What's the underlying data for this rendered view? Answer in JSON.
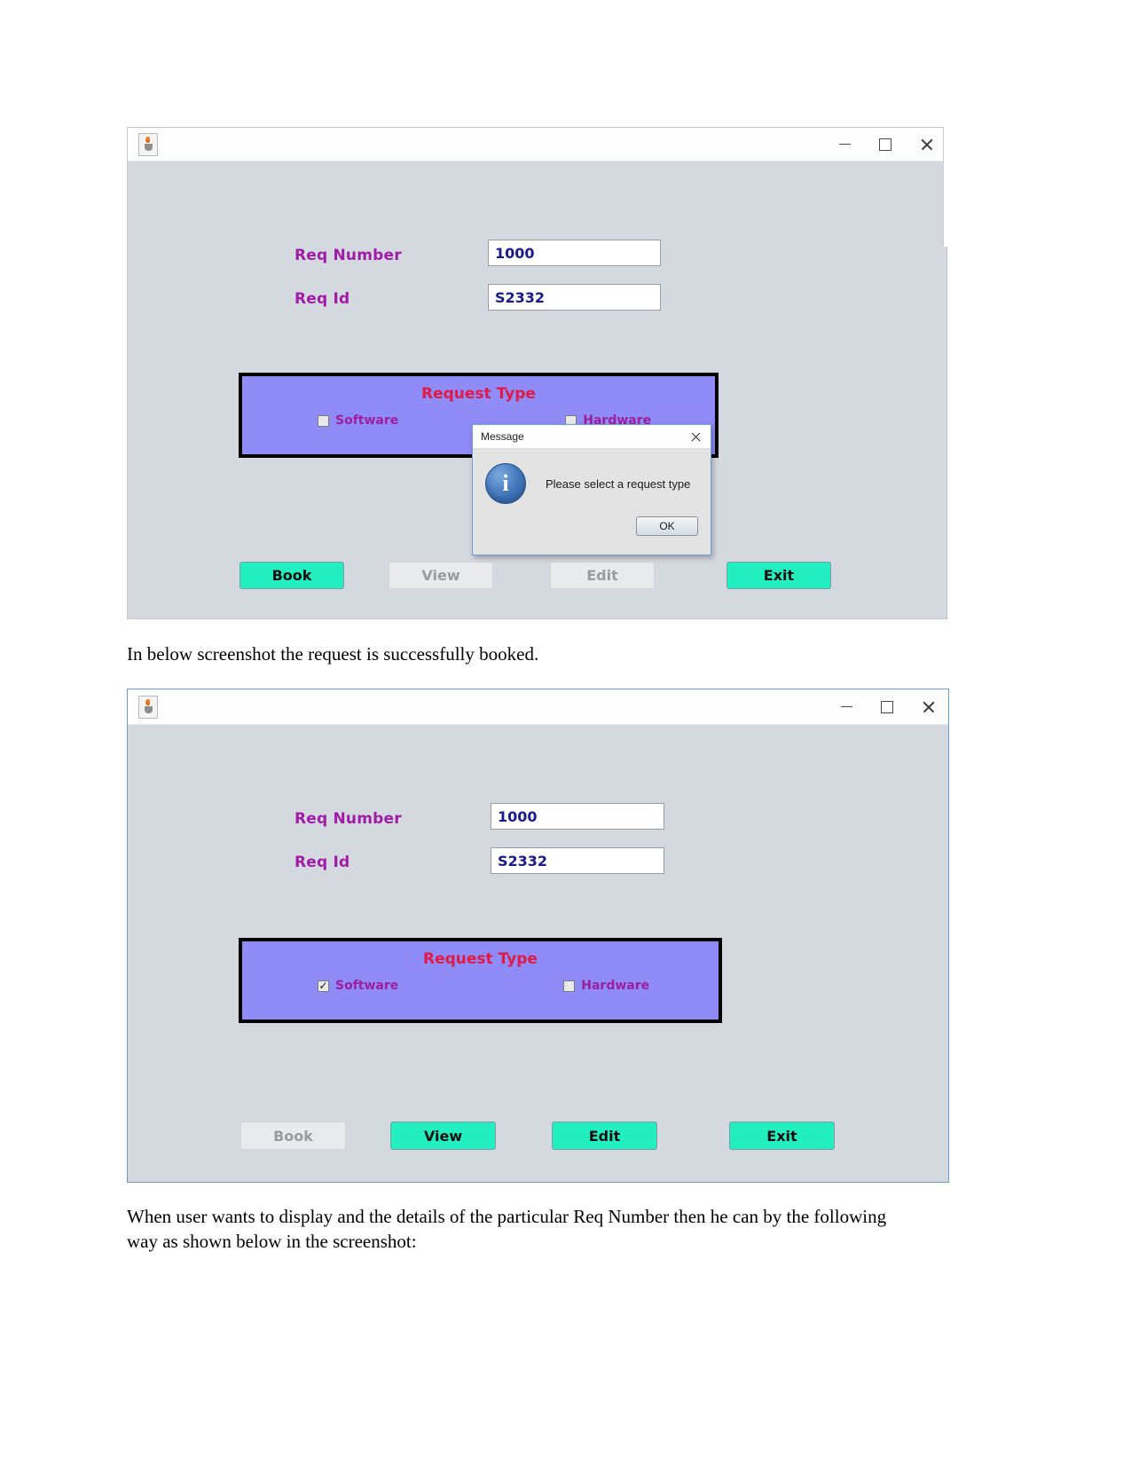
{
  "document": {
    "paragraph_1": "In below screenshot the request is successfully booked.",
    "paragraph_2": "When user wants to display and the details of the particular Req Number then he can by the following way as shown below in the screenshot:"
  },
  "colors": {
    "panel_background": "#8f8bf7",
    "panel_title": "#e01a45",
    "label": "#a01ca8",
    "input_text": "#1a1a8c",
    "button_active": "#21efc0",
    "button_disabled": "#e8eaec",
    "window_background": "#d4d8df"
  },
  "window_1": {
    "titlebar": {
      "app_icon": "java-cup-icon",
      "minimize": "minimize-icon",
      "maximize": "maximize-icon",
      "close": "close-icon"
    },
    "fields": [
      {
        "label": "Req Number",
        "value": "1000"
      },
      {
        "label": "Req Id",
        "value": "S2332"
      }
    ],
    "request_type": {
      "title": "Request Type",
      "options": [
        {
          "label": "Software",
          "checked": false
        },
        {
          "label": "Hardware",
          "checked": false
        }
      ]
    },
    "buttons": [
      {
        "label": "Book",
        "enabled": true
      },
      {
        "label": "View",
        "enabled": false
      },
      {
        "label": "Edit",
        "enabled": false
      },
      {
        "label": "Exit",
        "enabled": true
      }
    ],
    "dialog": {
      "title": "Message",
      "icon": "info-icon",
      "glyph": "i",
      "message": "Please select a request type",
      "ok_label": "OK",
      "close": "close-icon"
    }
  },
  "window_2": {
    "titlebar": {
      "app_icon": "java-cup-icon",
      "minimize": "minimize-icon",
      "maximize": "maximize-icon",
      "close": "close-icon"
    },
    "fields": [
      {
        "label": "Req Number",
        "value": "1000"
      },
      {
        "label": "Req Id",
        "value": "S2332"
      }
    ],
    "request_type": {
      "title": "Request Type",
      "options": [
        {
          "label": "Software",
          "checked": true,
          "mark": "✓"
        },
        {
          "label": "Hardware",
          "checked": false,
          "mark": ""
        }
      ]
    },
    "buttons": [
      {
        "label": "Book",
        "enabled": false
      },
      {
        "label": "View",
        "enabled": true
      },
      {
        "label": "Edit",
        "enabled": true
      },
      {
        "label": "Exit",
        "enabled": true
      }
    ]
  }
}
